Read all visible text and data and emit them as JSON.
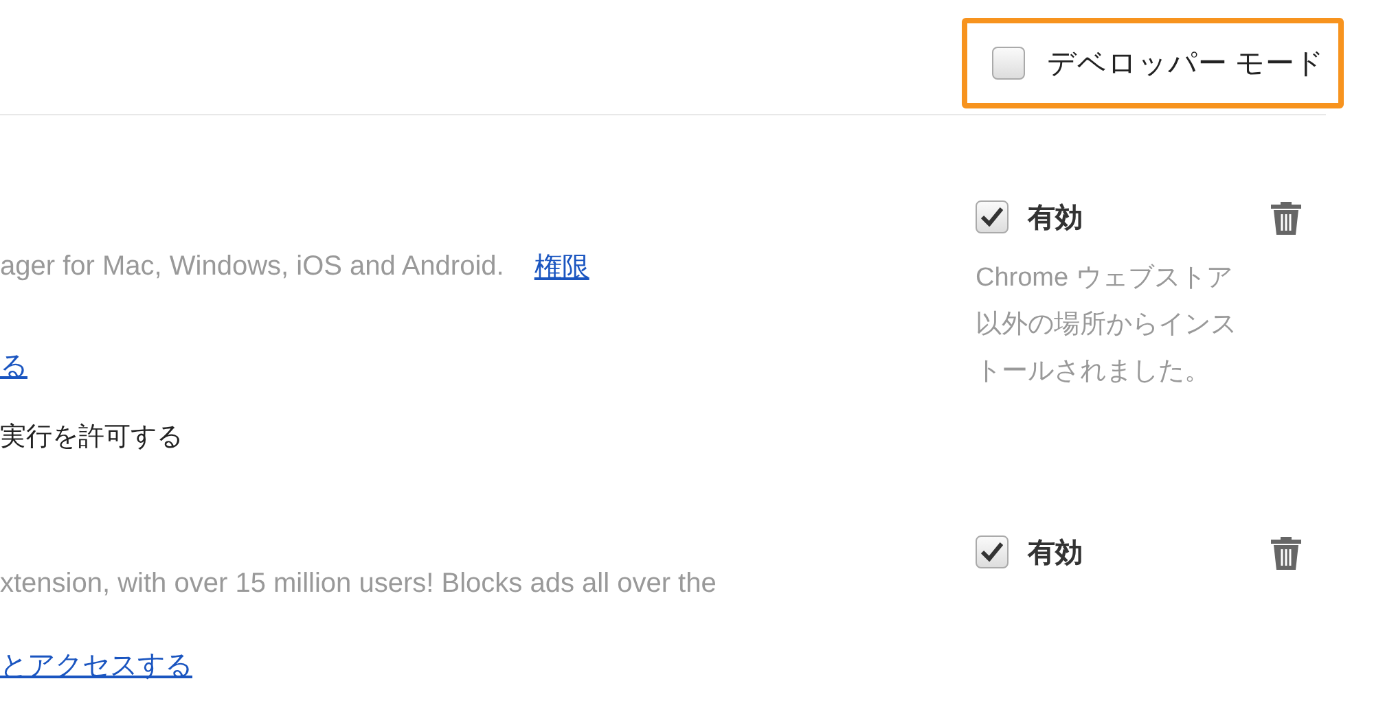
{
  "developer_mode": {
    "label": "デベロッパー モード",
    "checked": false
  },
  "extensions": [
    {
      "lines": [
        [
          {
            "kind": "text",
            "text": "ager for Mac, Windows, iOS and Android."
          },
          {
            "kind": "link",
            "text": "権限"
          }
        ],
        [
          {
            "kind": "link",
            "text": "る"
          }
        ],
        [
          {
            "kind": "option",
            "text": "実行を許可する"
          }
        ]
      ],
      "enabled": {
        "label": "有効",
        "checked": true
      },
      "note": "Chrome ウェブストア以外の場所からインストールされました。"
    },
    {
      "lines": [
        [
          {
            "kind": "text",
            "text": "xtension, with over 15 million users! Blocks ads all over the"
          }
        ],
        [
          {
            "kind": "link",
            "text": "とアクセスする"
          }
        ]
      ],
      "enabled": {
        "label": "有効",
        "checked": true
      }
    }
  ]
}
